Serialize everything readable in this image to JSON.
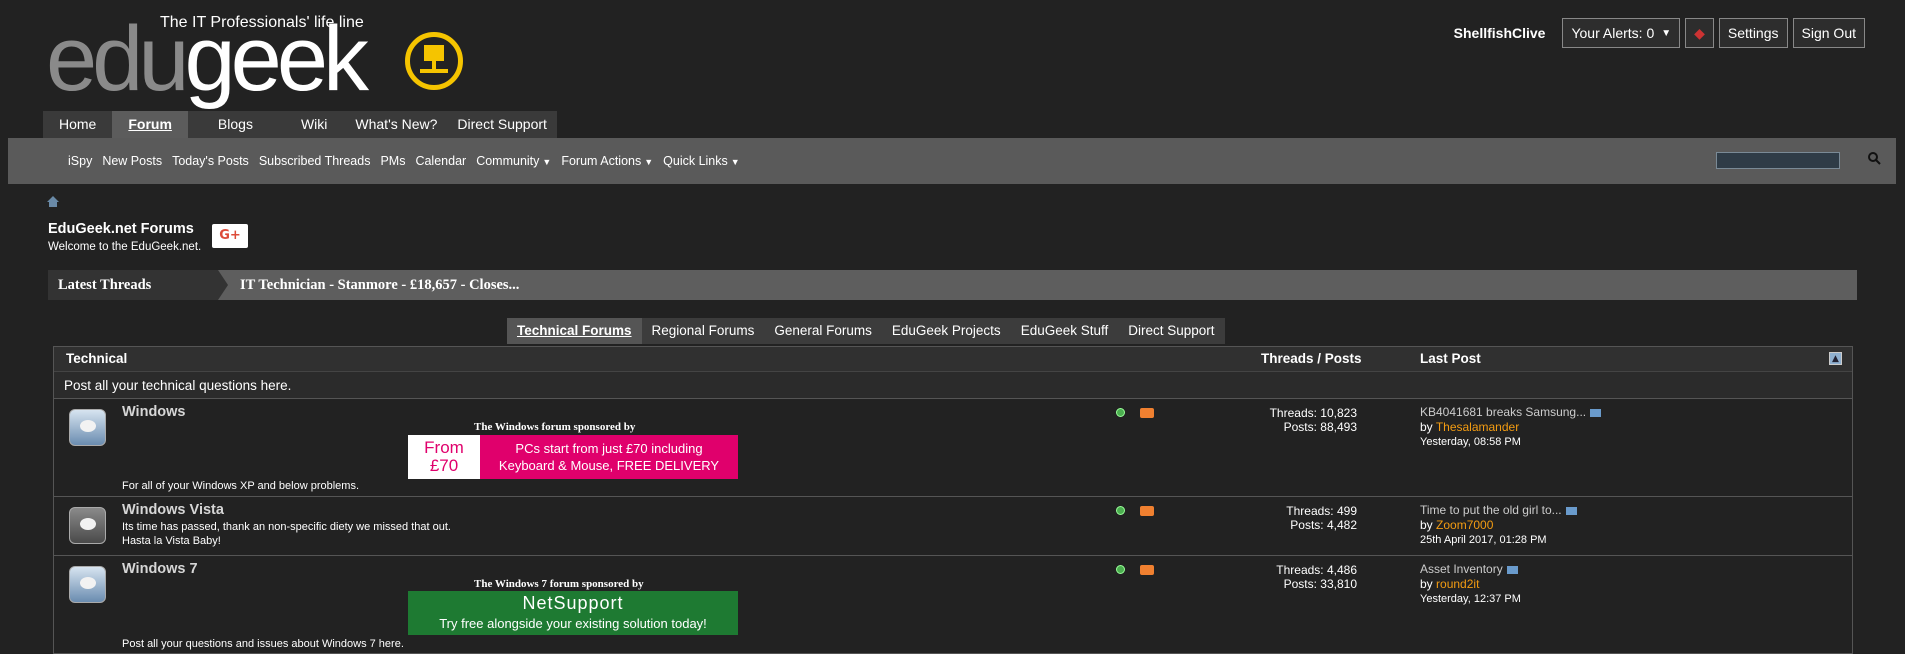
{
  "site": {
    "tagline": "The IT Professionals' life line",
    "logo_part1": "edu",
    "logo_part2": "geek"
  },
  "userbar": {
    "username": "ShellfishClive",
    "alerts": "Your Alerts: 0",
    "settings": "Settings",
    "signout": "Sign Out"
  },
  "navtabs": [
    "Home",
    "Forum",
    "Blogs",
    "Wiki",
    "What's New?",
    "Direct Support"
  ],
  "subnav": [
    "iSpy",
    "New Posts",
    "Today's Posts",
    "Subscribed Threads",
    "PMs",
    "Calendar",
    "Community",
    "Forum Actions",
    "Quick Links"
  ],
  "header": {
    "title": "EduGeek.net Forums",
    "welcome": "Welcome to the EduGeek.net.",
    "gplus": "G+"
  },
  "latest": {
    "label": "Latest Threads",
    "item": "IT Technician - Stanmore - £18,657 - Closes..."
  },
  "forumtabs": [
    "Technical Forums",
    "Regional Forums",
    "General Forums",
    "EduGeek Projects",
    "EduGeek Stuff",
    "Direct Support"
  ],
  "table": {
    "section": "Technical",
    "col_threads": "Threads / Posts",
    "col_lastpost": "Last Post",
    "description": "Post all your technical questions here."
  },
  "forums": [
    {
      "name": "Windows",
      "desc1": "For all of your Windows XP and below problems.",
      "desc2": "",
      "sponsor": "The Windows forum sponsored by",
      "banner_left1": "From",
      "banner_left2": "£70",
      "banner_right1": "PCs start from just £70 including",
      "banner_right2": "Keyboard & Mouse, FREE DELIVERY",
      "threads": "Threads: 10,823",
      "posts": "Posts: 88,493",
      "lp_title": "KB4041681 breaks Samsung...",
      "lp_by": "by",
      "lp_user": "Thesalamander",
      "lp_date": "Yesterday,",
      "lp_time": "08:58 PM"
    },
    {
      "name": "Windows Vista",
      "desc1": "Its time has passed, thank an non-specific diety we missed that out.",
      "desc2": "Hasta la Vista Baby!",
      "threads": "Threads: 499",
      "posts": "Posts: 4,482",
      "lp_title": "Time to put the old girl to...",
      "lp_by": "by",
      "lp_user": "Zoom7000",
      "lp_date": "25th April 2017,",
      "lp_time": "01:28 PM"
    },
    {
      "name": "Windows 7",
      "desc1": "Post all your questions and issues about Windows 7 here.",
      "sponsor": "The Windows 7 forum sponsored by",
      "banner_brand": "NetSupport",
      "banner_tag": "Try free alongside your existing solution today!",
      "threads": "Threads: 4,486",
      "posts": "Posts: 33,810",
      "lp_title": "Asset Inventory",
      "lp_by": "by",
      "lp_user": "round2it",
      "lp_date": "Yesterday,",
      "lp_time": "12:37 PM"
    }
  ]
}
